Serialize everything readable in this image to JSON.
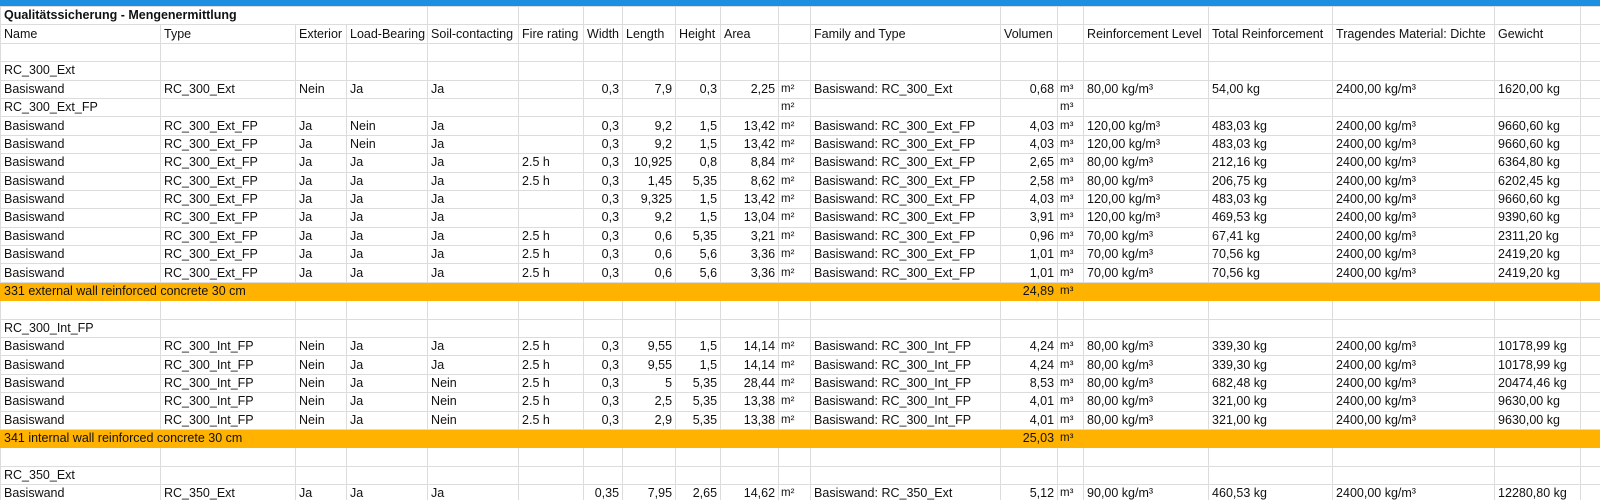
{
  "sheet": {
    "title": "Qualitätssicherung - Mengenermittlung",
    "headers": [
      "Name",
      "Type",
      "Exterior",
      "Load-Bearing",
      "Soil-contacting",
      "Fire rating",
      "Width",
      "Length",
      "Height",
      "Area",
      "",
      "Family and Type",
      "Volumen",
      "",
      "Reinforcement Level",
      "Total Reinforcement",
      "Tragendes Material: Dichte",
      "Gewicht",
      ""
    ],
    "rows": [
      {
        "kind": "blank",
        "cells": []
      },
      {
        "kind": "group",
        "cells": [
          "RC_300_Ext"
        ]
      },
      {
        "kind": "data",
        "cells": [
          "Basiswand",
          "RC_300_Ext",
          "Nein",
          "Ja",
          "Ja",
          "",
          "0,3",
          "7,9",
          "0,3",
          "2,25",
          "m²",
          "Basiswand: RC_300_Ext",
          "0,68",
          "m³",
          "80,00 kg/m³",
          "54,00 kg",
          "2400,00 kg/m³",
          "1620,00 kg",
          ""
        ]
      },
      {
        "kind": "group",
        "cells": [
          "RC_300_Ext_FP",
          "",
          "",
          "",
          "",
          "",
          "",
          "",
          "",
          "",
          "m²",
          "",
          "",
          "m³",
          "",
          "",
          "",
          "",
          ""
        ]
      },
      {
        "kind": "data",
        "cells": [
          "Basiswand",
          "RC_300_Ext_FP",
          "Ja",
          "Nein",
          "Ja",
          "",
          "0,3",
          "9,2",
          "1,5",
          "13,42",
          "m²",
          "Basiswand: RC_300_Ext_FP",
          "4,03",
          "m³",
          "120,00 kg/m³",
          "483,03 kg",
          "2400,00 kg/m³",
          "9660,60 kg",
          ""
        ]
      },
      {
        "kind": "data",
        "cells": [
          "Basiswand",
          "RC_300_Ext_FP",
          "Ja",
          "Nein",
          "Ja",
          "",
          "0,3",
          "9,2",
          "1,5",
          "13,42",
          "m²",
          "Basiswand: RC_300_Ext_FP",
          "4,03",
          "m³",
          "120,00 kg/m³",
          "483,03 kg",
          "2400,00 kg/m³",
          "9660,60 kg",
          ""
        ]
      },
      {
        "kind": "data",
        "cells": [
          "Basiswand",
          "RC_300_Ext_FP",
          "Ja",
          "Ja",
          "Ja",
          "2.5 h",
          "0,3",
          "10,925",
          "0,8",
          "8,84",
          "m²",
          "Basiswand: RC_300_Ext_FP",
          "2,65",
          "m³",
          "80,00 kg/m³",
          "212,16 kg",
          "2400,00 kg/m³",
          "6364,80 kg",
          ""
        ]
      },
      {
        "kind": "data",
        "cells": [
          "Basiswand",
          "RC_300_Ext_FP",
          "Ja",
          "Ja",
          "Ja",
          "2.5 h",
          "0,3",
          "1,45",
          "5,35",
          "8,62",
          "m²",
          "Basiswand: RC_300_Ext_FP",
          "2,58",
          "m³",
          "80,00 kg/m³",
          "206,75 kg",
          "2400,00 kg/m³",
          "6202,45 kg",
          ""
        ]
      },
      {
        "kind": "data",
        "cells": [
          "Basiswand",
          "RC_300_Ext_FP",
          "Ja",
          "Ja",
          "Ja",
          "",
          "0,3",
          "9,325",
          "1,5",
          "13,42",
          "m²",
          "Basiswand: RC_300_Ext_FP",
          "4,03",
          "m³",
          "120,00 kg/m³",
          "483,03 kg",
          "2400,00 kg/m³",
          "9660,60 kg",
          ""
        ]
      },
      {
        "kind": "data",
        "cells": [
          "Basiswand",
          "RC_300_Ext_FP",
          "Ja",
          "Ja",
          "Ja",
          "",
          "0,3",
          "9,2",
          "1,5",
          "13,04",
          "m²",
          "Basiswand: RC_300_Ext_FP",
          "3,91",
          "m³",
          "120,00 kg/m³",
          "469,53 kg",
          "2400,00 kg/m³",
          "9390,60 kg",
          ""
        ]
      },
      {
        "kind": "data",
        "cells": [
          "Basiswand",
          "RC_300_Ext_FP",
          "Ja",
          "Ja",
          "Ja",
          "2.5 h",
          "0,3",
          "0,6",
          "5,35",
          "3,21",
          "m²",
          "Basiswand: RC_300_Ext_FP",
          "0,96",
          "m³",
          "70,00 kg/m³",
          "67,41 kg",
          "2400,00 kg/m³",
          "2311,20 kg",
          ""
        ]
      },
      {
        "kind": "data",
        "cells": [
          "Basiswand",
          "RC_300_Ext_FP",
          "Ja",
          "Ja",
          "Ja",
          "2.5 h",
          "0,3",
          "0,6",
          "5,6",
          "3,36",
          "m²",
          "Basiswand: RC_300_Ext_FP",
          "1,01",
          "m³",
          "70,00 kg/m³",
          "70,56 kg",
          "2400,00 kg/m³",
          "2419,20 kg",
          ""
        ]
      },
      {
        "kind": "data",
        "cells": [
          "Basiswand",
          "RC_300_Ext_FP",
          "Ja",
          "Ja",
          "Ja",
          "2.5 h",
          "0,3",
          "0,6",
          "5,6",
          "3,36",
          "m²",
          "Basiswand: RC_300_Ext_FP",
          "1,01",
          "m³",
          "70,00 kg/m³",
          "70,56 kg",
          "2400,00 kg/m³",
          "2419,20 kg",
          ""
        ]
      },
      {
        "kind": "total",
        "label": "331 external wall reinforced concrete 30 cm",
        "volume": "24,89",
        "unit": "m³"
      },
      {
        "kind": "blank",
        "cells": []
      },
      {
        "kind": "group",
        "cells": [
          "RC_300_Int_FP"
        ]
      },
      {
        "kind": "data",
        "cells": [
          "Basiswand",
          "RC_300_Int_FP",
          "Nein",
          "Ja",
          "Ja",
          "2.5 h",
          "0,3",
          "9,55",
          "1,5",
          "14,14",
          "m²",
          "Basiswand: RC_300_Int_FP",
          "4,24",
          "m³",
          "80,00 kg/m³",
          "339,30 kg",
          "2400,00 kg/m³",
          "10178,99 kg",
          ""
        ]
      },
      {
        "kind": "data",
        "cells": [
          "Basiswand",
          "RC_300_Int_FP",
          "Nein",
          "Ja",
          "Ja",
          "2.5 h",
          "0,3",
          "9,55",
          "1,5",
          "14,14",
          "m²",
          "Basiswand: RC_300_Int_FP",
          "4,24",
          "m³",
          "80,00 kg/m³",
          "339,30 kg",
          "2400,00 kg/m³",
          "10178,99 kg",
          ""
        ]
      },
      {
        "kind": "data",
        "cells": [
          "Basiswand",
          "RC_300_Int_FP",
          "Nein",
          "Ja",
          "Nein",
          "2.5 h",
          "0,3",
          "5",
          "5,35",
          "28,44",
          "m²",
          "Basiswand: RC_300_Int_FP",
          "8,53",
          "m³",
          "80,00 kg/m³",
          "682,48 kg",
          "2400,00 kg/m³",
          "20474,46 kg",
          ""
        ]
      },
      {
        "kind": "data",
        "cells": [
          "Basiswand",
          "RC_300_Int_FP",
          "Nein",
          "Ja",
          "Nein",
          "2.5 h",
          "0,3",
          "2,5",
          "5,35",
          "13,38",
          "m²",
          "Basiswand: RC_300_Int_FP",
          "4,01",
          "m³",
          "80,00 kg/m³",
          "321,00 kg",
          "2400,00 kg/m³",
          "9630,00 kg",
          ""
        ]
      },
      {
        "kind": "data",
        "cells": [
          "Basiswand",
          "RC_300_Int_FP",
          "Nein",
          "Ja",
          "Nein",
          "2.5 h",
          "0,3",
          "2,9",
          "5,35",
          "13,38",
          "m²",
          "Basiswand: RC_300_Int_FP",
          "4,01",
          "m³",
          "80,00 kg/m³",
          "321,00 kg",
          "2400,00 kg/m³",
          "9630,00 kg",
          ""
        ]
      },
      {
        "kind": "total",
        "label": "341 internal wall reinforced concrete 30 cm",
        "volume": "25,03",
        "unit": "m³"
      },
      {
        "kind": "blank",
        "cells": []
      },
      {
        "kind": "group",
        "cells": [
          "RC_350_Ext"
        ]
      },
      {
        "kind": "data",
        "cells": [
          "Basiswand",
          "RC_350_Ext",
          "Ja",
          "Ja",
          "Ja",
          "",
          "0,35",
          "7,95",
          "2,65",
          "14,62",
          "m²",
          "Basiswand: RC_350_Ext",
          "5,12",
          "m³",
          "90,00 kg/m³",
          "460,53 kg",
          "2400,00 kg/m³",
          "12280,80 kg",
          ""
        ]
      }
    ]
  }
}
